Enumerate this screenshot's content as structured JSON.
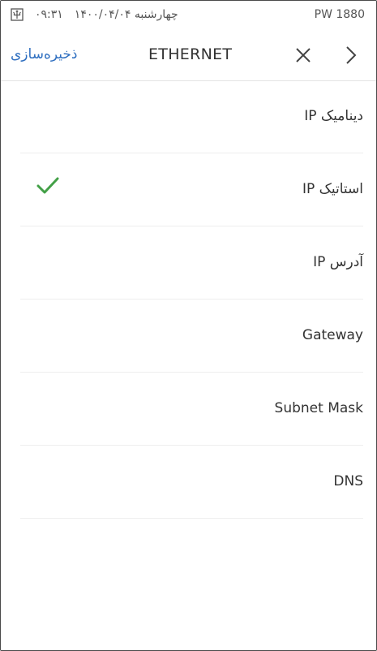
{
  "status_bar": {
    "time": "۰۹:۳۱",
    "date": "چهارشنبه ۱۴۰۰/۰۴/۰۴",
    "device_model": "PW 1880"
  },
  "nav": {
    "save_label": "ذخیره‌سازی",
    "title": "ETHERNET",
    "close_icon": "close-icon",
    "back_icon": "chevron-right-icon"
  },
  "items": [
    {
      "label": "دینامیک IP",
      "selected": false
    },
    {
      "label": "استاتیک IP",
      "selected": true
    },
    {
      "label": "آدرس IP",
      "selected": false
    },
    {
      "label": "Gateway",
      "selected": false
    },
    {
      "label": "Subnet Mask",
      "selected": false
    },
    {
      "label": "DNS",
      "selected": false
    }
  ],
  "colors": {
    "accent": "#2f6fc0",
    "check": "#43a047",
    "text": "#333333",
    "divider": "#eeeeee"
  }
}
